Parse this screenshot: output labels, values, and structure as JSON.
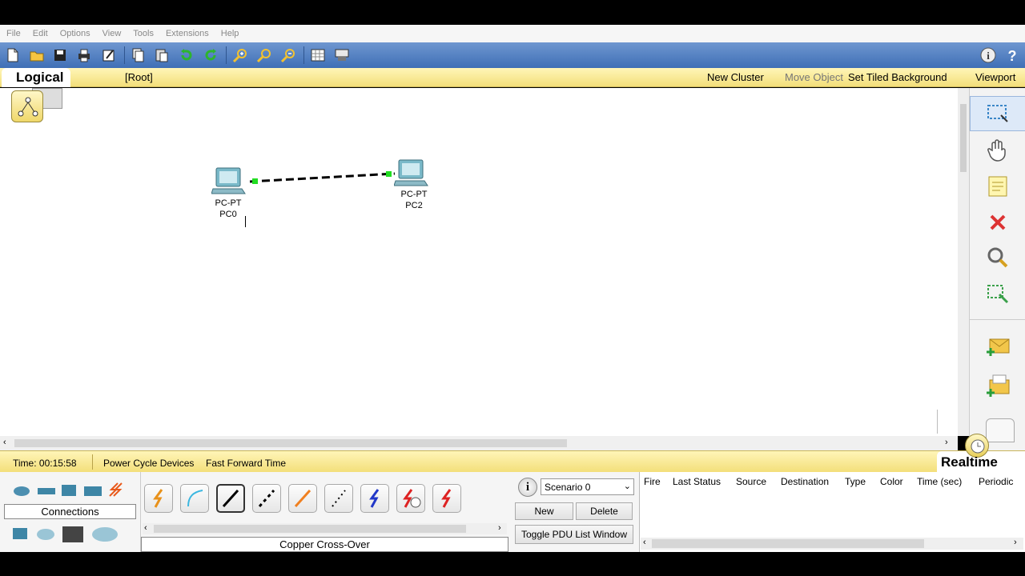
{
  "menu": [
    "File",
    "Edit",
    "Options",
    "View",
    "Tools",
    "Extensions",
    "Help"
  ],
  "workspace": {
    "tab": "Logical",
    "root": "[Root]",
    "new_cluster": "New Cluster",
    "move_object": "Move Object",
    "set_tiled_background": "Set Tiled Background",
    "viewport": "Viewport"
  },
  "devices": [
    {
      "type": "PC-PT",
      "name": "PC0"
    },
    {
      "type": "PC-PT",
      "name": "PC2"
    }
  ],
  "status": {
    "time": "Time: 00:15:58",
    "power_cycle": "Power Cycle Devices",
    "fast_forward": "Fast Forward Time",
    "mode": "Realtime"
  },
  "device_panel": {
    "category_label": "Connections",
    "selected_connection": "Copper Cross-Over"
  },
  "scenario": {
    "selected": "Scenario 0",
    "new_label": "New",
    "delete_label": "Delete",
    "toggle_label": "Toggle PDU List Window"
  },
  "pdu_table": {
    "columns": [
      "Fire",
      "Last Status",
      "Source",
      "Destination",
      "Type",
      "Color",
      "Time (sec)",
      "Periodic"
    ]
  },
  "colors": {
    "toolbar": "#4f7ec2",
    "workspace_bar": "#f7e79a",
    "link_light": "#22dd22"
  }
}
